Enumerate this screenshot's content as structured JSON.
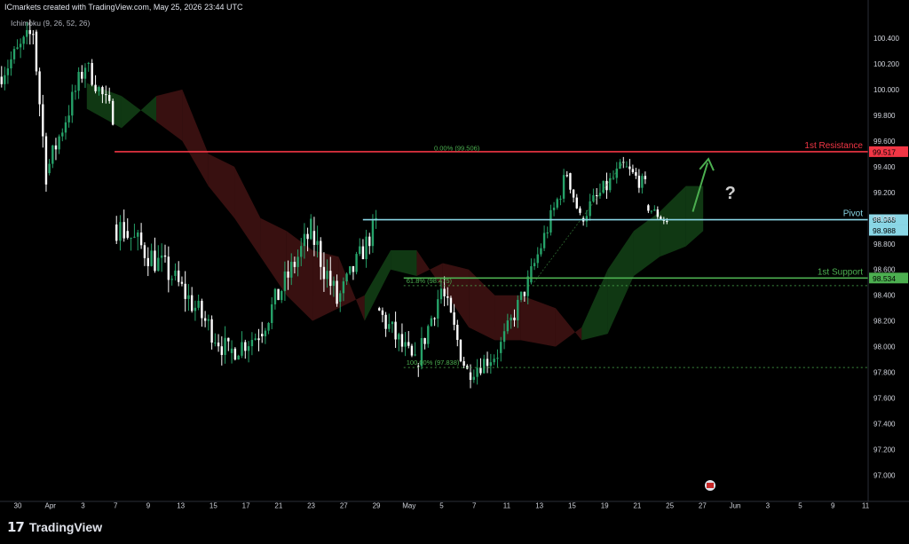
{
  "header": {
    "credit": "ICmarkets created with TradingView.com, May 25, 2026 23:44 UTC",
    "indicator": "Ichimoku (9, 26, 52, 26)"
  },
  "footer": {
    "brand": "TradingView"
  },
  "colors": {
    "bg": "#000000",
    "up": "#26a269",
    "down": "#ffffff",
    "resistance": "#f23645",
    "pivot": "#8ad7e6",
    "support": "#4caf50",
    "cloud_bull": "#1b5e20",
    "cloud_bear": "#5d1a1a",
    "arrow": "#4caf50"
  },
  "chart_data": {
    "type": "candlestick",
    "y_axis": {
      "ticks": [
        "100.400",
        "100.200",
        "100.000",
        "99.800",
        "99.600",
        "99.400",
        "99.200",
        "99.000",
        "98.800",
        "98.600",
        "98.400",
        "98.200",
        "98.000",
        "97.800",
        "97.600",
        "97.400",
        "97.200",
        "97.000"
      ],
      "ylim": [
        96.9,
        100.6
      ]
    },
    "x_axis": {
      "ticks": [
        "30",
        "Apr",
        "3",
        "7",
        "9",
        "13",
        "15",
        "17",
        "21",
        "23",
        "27",
        "29",
        "May",
        "5",
        "7",
        "11",
        "13",
        "15",
        "19",
        "21",
        "25",
        "27",
        "Jun",
        "3",
        "5",
        "9",
        "11"
      ]
    },
    "levels": [
      {
        "label": "1st Resistance",
        "value": 99.517,
        "price_label": "99.517",
        "color": "#f23645",
        "from": 0.132
      },
      {
        "label": "Pivot",
        "value": 98.988,
        "price_label": "98.988",
        "color": "#8ad7e6",
        "from": 0.418
      },
      {
        "label": "1st Support",
        "value": 98.534,
        "price_label": "98.534",
        "color": "#4caf50",
        "from": 0.465
      }
    ],
    "fib": [
      {
        "label": "0.00% (99.506)",
        "value": 99.506
      },
      {
        "label": "61.8% (98.475)",
        "value": 98.475
      },
      {
        "label": "100.00% (97.838)",
        "value": 97.838
      }
    ],
    "current_price_label": "98.988",
    "question_mark": "?",
    "segments": [
      {
        "t0": 0.0,
        "t1": 0.04,
        "start": 100.1,
        "end": 100.45,
        "vol": 0.18
      },
      {
        "t0": 0.04,
        "t1": 0.055,
        "start": 100.45,
        "end": 99.35,
        "vol": 0.2
      },
      {
        "t0": 0.055,
        "t1": 0.1,
        "start": 99.35,
        "end": 100.2,
        "vol": 0.18
      },
      {
        "t0": 0.1,
        "t1": 0.132,
        "start": 100.2,
        "end": 99.8,
        "vol": 0.15
      },
      {
        "t0": 0.132,
        "t1": 0.145,
        "start": 98.95,
        "end": 98.9,
        "vol": 0.22
      },
      {
        "t0": 0.145,
        "t1": 0.2,
        "start": 98.9,
        "end": 98.55,
        "vol": 0.22
      },
      {
        "t0": 0.2,
        "t1": 0.265,
        "start": 98.55,
        "end": 97.95,
        "vol": 0.2
      },
      {
        "t0": 0.265,
        "t1": 0.3,
        "start": 97.95,
        "end": 98.1,
        "vol": 0.18
      },
      {
        "t0": 0.3,
        "t1": 0.36,
        "start": 98.1,
        "end": 98.9,
        "vol": 0.2
      },
      {
        "t0": 0.36,
        "t1": 0.39,
        "start": 98.9,
        "end": 98.35,
        "vol": 0.25
      },
      {
        "t0": 0.39,
        "t1": 0.435,
        "start": 98.35,
        "end": 98.95,
        "vol": 0.18
      },
      {
        "t0": 0.435,
        "t1": 0.48,
        "start": 98.3,
        "end": 97.85,
        "vol": 0.2
      },
      {
        "t0": 0.48,
        "t1": 0.51,
        "start": 97.85,
        "end": 98.45,
        "vol": 0.18
      },
      {
        "t0": 0.51,
        "t1": 0.54,
        "start": 98.45,
        "end": 97.8,
        "vol": 0.2
      },
      {
        "t0": 0.54,
        "t1": 0.575,
        "start": 97.8,
        "end": 97.95,
        "vol": 0.15
      },
      {
        "t0": 0.575,
        "t1": 0.61,
        "start": 97.95,
        "end": 98.5,
        "vol": 0.15
      },
      {
        "t0": 0.61,
        "t1": 0.655,
        "start": 98.5,
        "end": 99.35,
        "vol": 0.15
      },
      {
        "t0": 0.655,
        "t1": 0.67,
        "start": 99.35,
        "end": 99.0,
        "vol": 0.12
      },
      {
        "t0": 0.67,
        "t1": 0.72,
        "start": 99.0,
        "end": 99.4,
        "vol": 0.15
      },
      {
        "t0": 0.72,
        "t1": 0.745,
        "start": 99.4,
        "end": 99.25,
        "vol": 0.12
      },
      {
        "t0": 0.745,
        "t1": 0.77,
        "start": 99.1,
        "end": 98.97,
        "vol": 0.08
      }
    ],
    "cloud": [
      {
        "t": 0.1,
        "a": 100.05,
        "b": 99.85
      },
      {
        "t": 0.14,
        "a": 99.95,
        "b": 99.7
      },
      {
        "t": 0.18,
        "a": 99.75,
        "b": 99.95
      },
      {
        "t": 0.21,
        "a": 99.6,
        "b": 100.0
      },
      {
        "t": 0.24,
        "a": 99.25,
        "b": 99.5
      },
      {
        "t": 0.27,
        "a": 99.0,
        "b": 99.4
      },
      {
        "t": 0.3,
        "a": 98.7,
        "b": 99.0
      },
      {
        "t": 0.33,
        "a": 98.4,
        "b": 98.9
      },
      {
        "t": 0.36,
        "a": 98.2,
        "b": 98.75
      },
      {
        "t": 0.39,
        "a": 98.3,
        "b": 98.7
      },
      {
        "t": 0.42,
        "a": 98.4,
        "b": 98.2
      },
      {
        "t": 0.45,
        "a": 98.75,
        "b": 98.6
      },
      {
        "t": 0.48,
        "a": 98.75,
        "b": 98.55
      },
      {
        "t": 0.51,
        "a": 98.45,
        "b": 98.65
      },
      {
        "t": 0.54,
        "a": 98.15,
        "b": 98.6
      },
      {
        "t": 0.57,
        "a": 98.05,
        "b": 98.4
      },
      {
        "t": 0.6,
        "a": 98.05,
        "b": 98.4
      },
      {
        "t": 0.64,
        "a": 98.0,
        "b": 98.3
      },
      {
        "t": 0.67,
        "a": 98.15,
        "b": 98.05
      },
      {
        "t": 0.7,
        "a": 98.6,
        "b": 98.1
      },
      {
        "t": 0.73,
        "a": 98.9,
        "b": 98.55
      },
      {
        "t": 0.76,
        "a": 99.05,
        "b": 98.7
      },
      {
        "t": 0.79,
        "a": 99.25,
        "b": 98.78
      },
      {
        "t": 0.81,
        "a": 99.25,
        "b": 98.9
      }
    ]
  }
}
